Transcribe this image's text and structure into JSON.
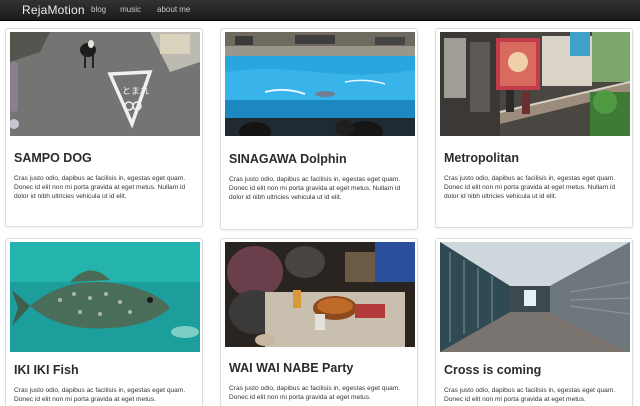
{
  "navbar": {
    "brand": "RejaMotion",
    "links": [
      "blog",
      "music",
      "about me"
    ]
  },
  "cards": [
    {
      "title": "SAMPO DOG",
      "text": "Cras justo odio, dapibus ac facilisis in, egestas eget quam. Donec id elit non mi porta gravida at eget metus. Nullam id dolor id nibh ultricies vehicula ut id elit.",
      "photo": "dog-on-street-photo"
    },
    {
      "title": "SINAGAWA Dolphin",
      "text": "Cras justo odio, dapibus ac facilisis in, egestas eget quam. Donec id elit non mi porta gravida at eget metus. Nullam id dolor id nibh ultricies vehicula ut id elit.",
      "photo": "dolphin-pool-photo"
    },
    {
      "title": "Metropolitan",
      "text": "Cras justo odio, dapibus ac facilisis in, egestas eget quam. Donec id elit non mi porta gravida at eget metus. Nullam id dolor id nibh ultricies vehicula ut id elit.",
      "photo": "city-mall-photo"
    },
    {
      "title": "IKI IKI Fish",
      "text": "Cras justo odio, dapibus ac facilisis in, egestas eget quam. Donec id elit non mi porta gravida at eget metus.",
      "photo": "fish-aquarium-photo"
    },
    {
      "title": "WAI WAI NABE Party",
      "text": "Cras justo odio, dapibus ac facilisis in, egestas eget quam. Donec id elit non mi porta gravida at eget metus.",
      "photo": "nabe-party-photo"
    },
    {
      "title": "Cross is coming",
      "text": "Cras justo odio, dapibus ac facilisis in, egestas eget quam. Donec id elit non mi porta gravida at eget metus.",
      "photo": "station-corridor-photo"
    }
  ]
}
